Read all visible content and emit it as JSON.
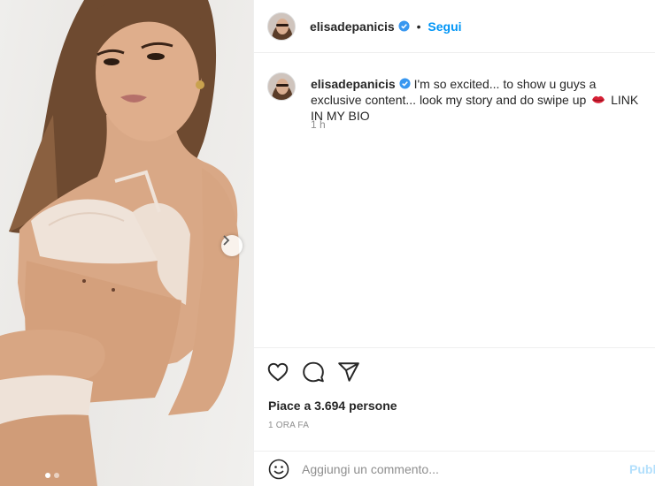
{
  "post": {
    "username": "elisadepanicis",
    "separator": "•",
    "follow_label": "Segui",
    "caption_text": "I'm so excited... to show u guys a exclusive content... look my story and do swipe up",
    "caption_suffix": "LINK IN MY BIO",
    "caption_age": "1 h",
    "likes_text": "Piace a 3.694 persone",
    "timestamp": "1 ORA FA"
  },
  "carousel": {
    "slide_count": 2,
    "active_slide": 1
  },
  "comment_box": {
    "placeholder": "Aggiungi un commento...",
    "publish_label": "Pubb"
  },
  "icons": {
    "verified": "verified-badge-icon",
    "next": "chevron-right-icon",
    "like": "heart-icon",
    "comment": "comment-bubble-icon",
    "share": "paper-plane-icon",
    "emoji": "emoji-smiley-icon",
    "lips": "lips-emoji-icon"
  },
  "colors": {
    "link_blue": "#0095f6",
    "verified_blue": "#3897f0",
    "muted_text": "#8e8e8e",
    "publish_disabled": "#b2dffc"
  }
}
